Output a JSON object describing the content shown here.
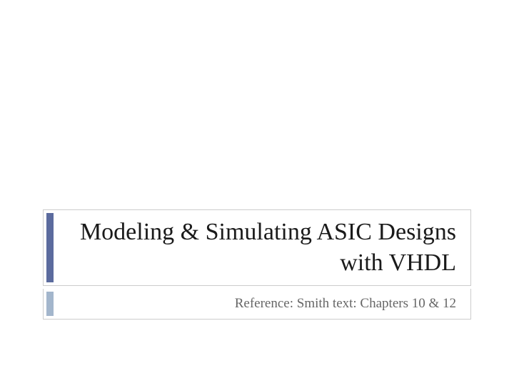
{
  "slide": {
    "title": "Modeling & Simulating ASIC Designs with VHDL",
    "subtitle": "Reference: Smith text: Chapters 10 & 12"
  }
}
